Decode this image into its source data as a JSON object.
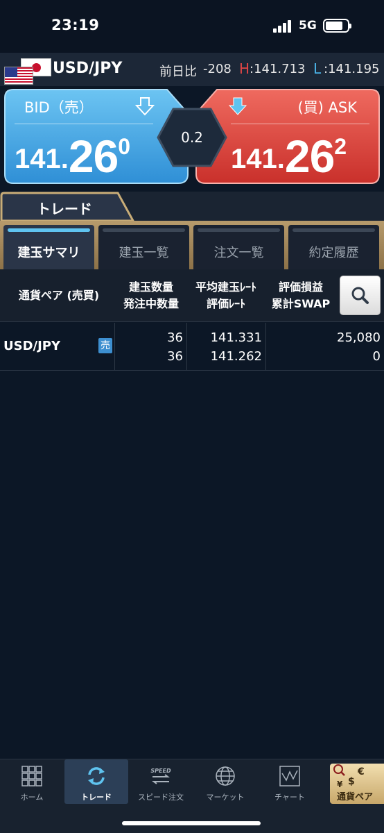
{
  "status": {
    "time": "23:19",
    "network": "5G"
  },
  "pair": {
    "name": "USD/JPY",
    "change_label": "前日比",
    "change_value": "-208",
    "high_label": "H",
    "high_value": ":141.713",
    "low_label": "L",
    "low_value": ":141.195"
  },
  "quote": {
    "bid_label": "BID（売）",
    "bid_main": "141.",
    "bid_big": "26",
    "bid_sup": "0",
    "ask_label": "(買) ASK",
    "ask_main": "141.",
    "ask_big": "26",
    "ask_sup": "2",
    "spread": "0.2",
    "bid_color": "#4fb0e9",
    "ask_color": "#e2473e"
  },
  "trade_tab": "トレード",
  "subtabs": [
    {
      "label": "建玉サマリ",
      "active": true
    },
    {
      "label": "建玉一覧",
      "active": false
    },
    {
      "label": "注文一覧",
      "active": false
    },
    {
      "label": "約定履歴",
      "active": false
    }
  ],
  "columns": {
    "pair": "通貨ペア (売買)",
    "qty_line1": "建玉数量",
    "qty_line2": "発注中数量",
    "rate_line1": "平均建玉ﾚｰﾄ",
    "rate_line2": "評価ﾚｰﾄ",
    "pl_line1": "評価損益",
    "pl_line2": "累計SWAP"
  },
  "rows": [
    {
      "pair": "USD/JPY",
      "side": "売",
      "position_qty": "36",
      "order_qty": "36",
      "avg_rate": "141.331",
      "eval_rate": "141.262",
      "pl": "25,080",
      "swap": "0"
    }
  ],
  "nav": {
    "home": "ホーム",
    "trade": "トレード",
    "speed": "スピード注文",
    "market": "マーケット",
    "chart": "チャート",
    "pairs": "通貨ペア",
    "speed_icon_text": "SPEED"
  }
}
